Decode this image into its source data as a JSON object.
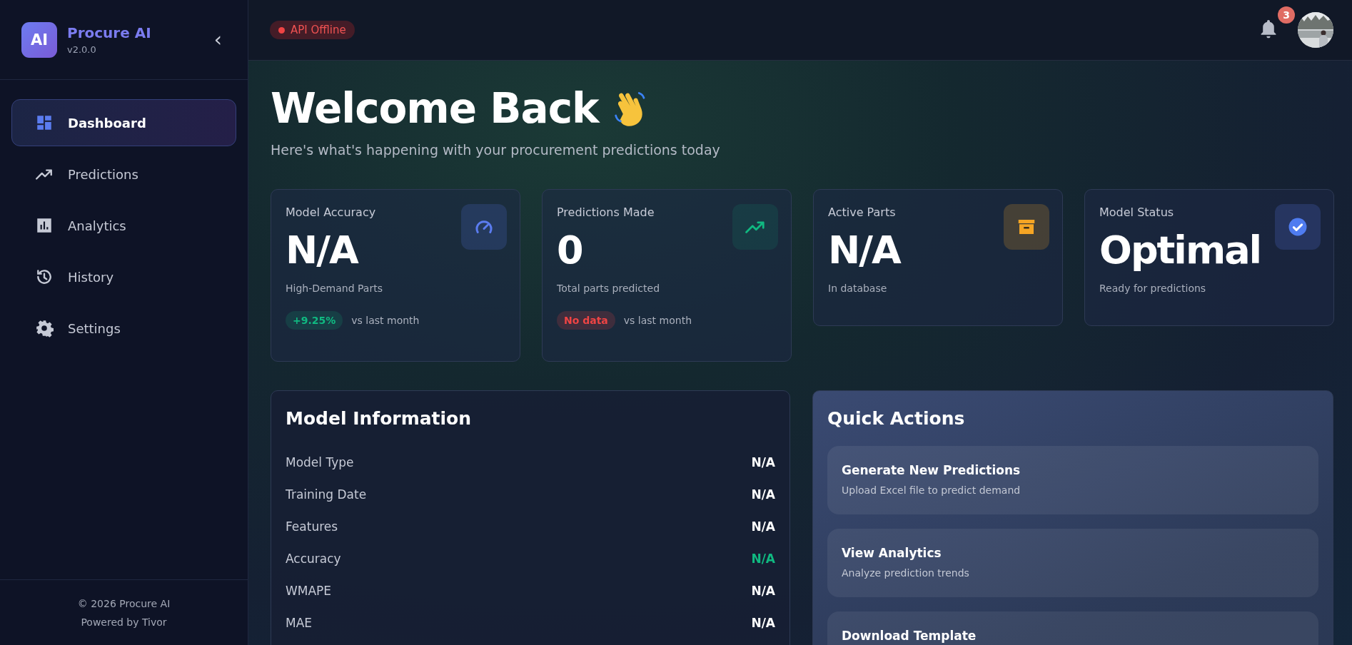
{
  "sidebar": {
    "logo_mark": "AI",
    "app_name": "Procure AI",
    "version": "v2.0.0",
    "collapse_glyph": "‹",
    "items": [
      {
        "label": "Dashboard",
        "selected": true
      },
      {
        "label": "Predictions",
        "selected": false
      },
      {
        "label": "Analytics",
        "selected": false
      },
      {
        "label": "History",
        "selected": false
      },
      {
        "label": "Settings",
        "selected": false
      }
    ],
    "footer": [
      "© 2026 Procure AI",
      "Powered by Tivor"
    ]
  },
  "topbar": {
    "api_status": {
      "label": "API Offline",
      "online": false
    },
    "notifications": "3"
  },
  "welcome": {
    "title": "Welcome Back",
    "subtitle": "Here's what's happening with your procurement predictions today"
  },
  "stats": [
    {
      "title": "Model Accuracy",
      "value": "N/A",
      "caption": "High-Demand Parts",
      "change": {
        "text": "+9.25%",
        "kind": "positive",
        "note": "vs last month"
      }
    },
    {
      "title": "Predictions Made",
      "value": "0",
      "caption": "Total parts predicted",
      "change": {
        "text": "No data",
        "kind": "negative",
        "note": "vs last month"
      }
    },
    {
      "title": "Active Parts",
      "value": "N/A",
      "caption": "In database"
    },
    {
      "title": "Model Status",
      "value": "Optimal",
      "caption": "Ready for predictions"
    }
  ],
  "model_information": {
    "title": "Model Information",
    "rows": [
      {
        "label": "Model Type",
        "value": "N/A",
        "kind": "plain"
      },
      {
        "label": "Training Date",
        "value": "N/A",
        "kind": "plain"
      },
      {
        "label": "Features",
        "value": "N/A",
        "kind": "plain"
      },
      {
        "label": "Accuracy",
        "value": "N/A",
        "kind": "positive"
      },
      {
        "label": "WMAPE",
        "value": "N/A",
        "kind": "plain"
      },
      {
        "label": "MAE",
        "value": "N/A",
        "kind": "plain"
      }
    ]
  },
  "quick_actions": {
    "title": "Quick Actions",
    "items": [
      {
        "title": "Generate New Predictions",
        "description": "Upload Excel file to predict demand"
      },
      {
        "title": "View Analytics",
        "description": "Analyze prediction trends"
      },
      {
        "title": "Download Template"
      }
    ]
  }
}
